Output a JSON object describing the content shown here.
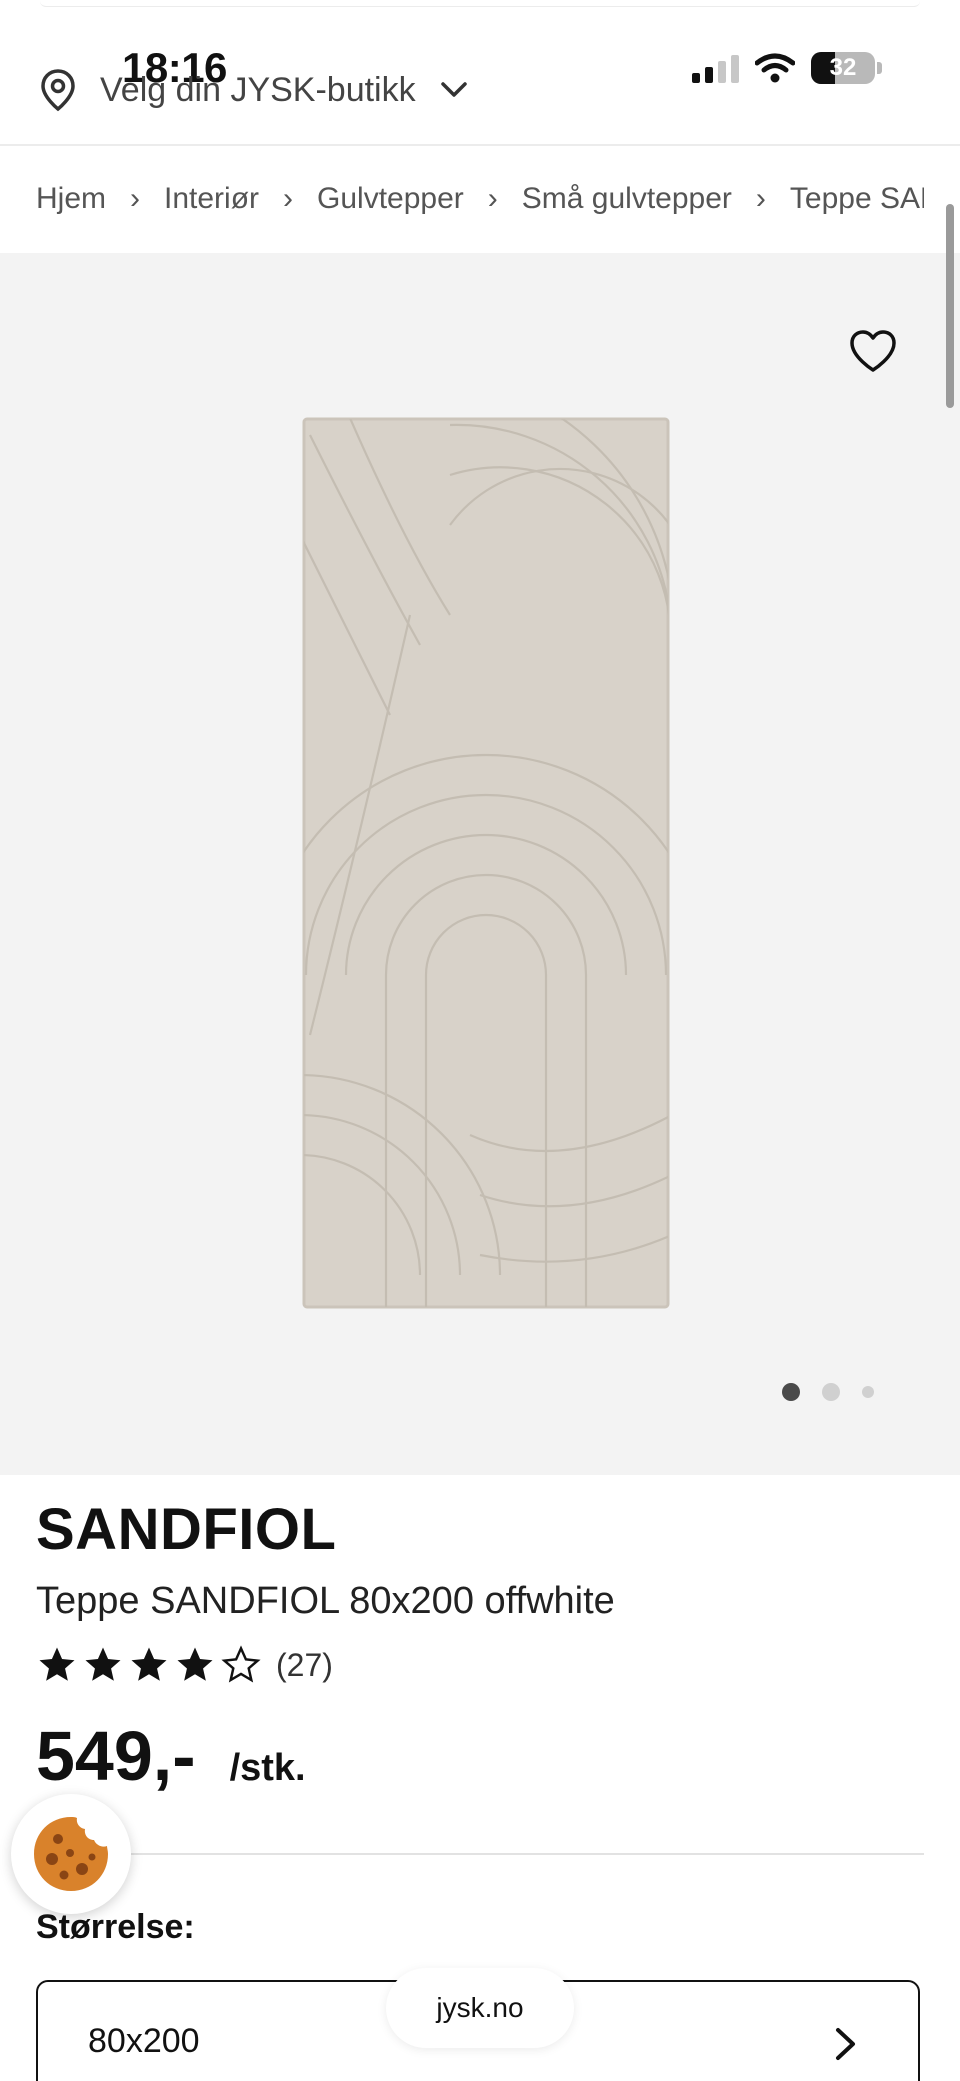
{
  "status_bar": {
    "time": "18:16",
    "battery": "32",
    "icons": [
      "signal-icon",
      "wifi-icon",
      "battery-icon"
    ]
  },
  "header": {
    "store_label": "Velg din JYSK-butikk",
    "icons": [
      "location-pin-icon",
      "chevron-down-icon"
    ]
  },
  "breadcrumb": {
    "items": [
      "Hjem",
      "Interiør",
      "Gulvtepper",
      "Små gulvtepper",
      "Teppe SANDFIOL"
    ]
  },
  "gallery": {
    "image": "rug-image",
    "active_index": 1,
    "dot_count": 3,
    "favorite_icon": "heart-icon"
  },
  "product": {
    "brand": "SANDFIOL",
    "name": "Teppe SANDFIOL 80x200 offwhite",
    "rating": {
      "stars": 4,
      "max": 5,
      "count": "(27)"
    },
    "price": "549,-",
    "unit": "/stk."
  },
  "cookie_button": {
    "icon": "cookie-icon"
  },
  "size": {
    "label": "Størrelse:",
    "selected": "80x200",
    "icon": "chevron-right-icon"
  },
  "browser": {
    "url": "jysk.no"
  },
  "colors": {
    "gallery_bg": "#f3f3f3",
    "rug": "#d8d2c9",
    "text": "#111111"
  }
}
